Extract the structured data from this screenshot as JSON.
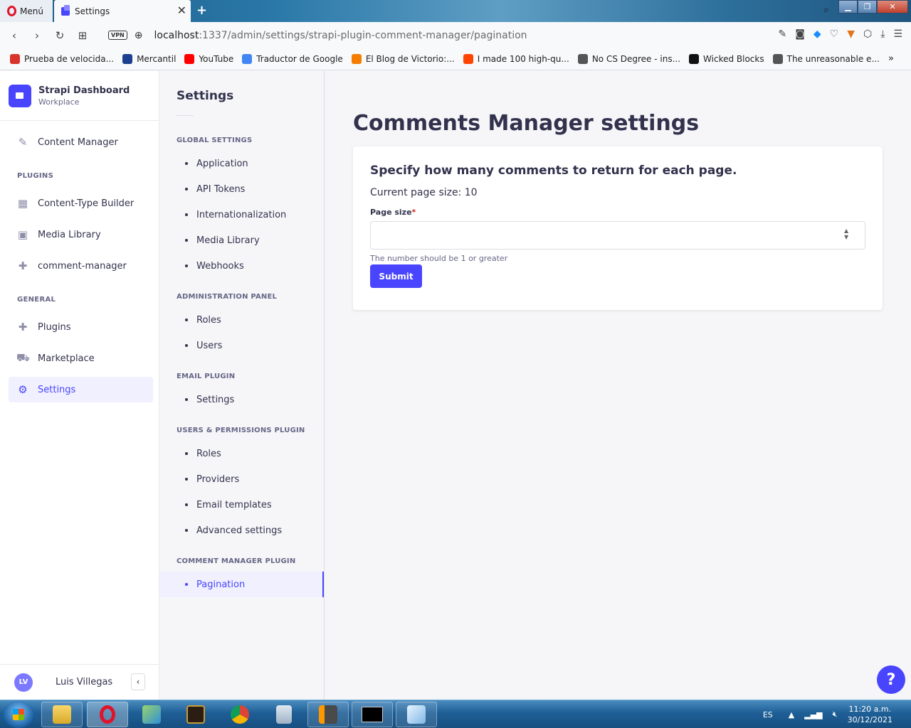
{
  "browser": {
    "menu_label": "Menú",
    "tab_title": "Settings",
    "tab_close": "✕",
    "new_tab": "+",
    "url_host": "localhost",
    "url_path": ":1337/admin/settings/strapi-plugin-comment-manager/pagination",
    "vpn_label": "VPN",
    "bookmarks": [
      {
        "label": "Prueba de velocida...",
        "color": "#d9342b"
      },
      {
        "label": "Mercantil",
        "color": "#1d3f8f"
      },
      {
        "label": "YouTube",
        "color": "#ff0000"
      },
      {
        "label": "Traductor de Google",
        "color": "#4285f4"
      },
      {
        "label": "El Blog de Victorio:...",
        "color": "#f57d00"
      },
      {
        "label": "I made 100 high-qu...",
        "color": "#ff4500"
      },
      {
        "label": "No CS Degree - ins...",
        "color": "#555555"
      },
      {
        "label": "Wicked Blocks",
        "color": "#111111"
      },
      {
        "label": "The unreasonable e...",
        "color": "#555555"
      }
    ],
    "more_bookmarks": "»"
  },
  "strapi": {
    "brand_title": "Strapi Dashboard",
    "brand_subtitle": "Workplace",
    "nav_content_manager": "Content Manager",
    "section_plugins": "PLUGINS",
    "nav_ctb": "Content-Type Builder",
    "nav_media": "Media Library",
    "nav_comment": "comment-manager",
    "section_general": "GENERAL",
    "nav_plugins": "Plugins",
    "nav_marketplace": "Marketplace",
    "nav_settings": "Settings",
    "user_initials": "LV",
    "user_name": "Luis Villegas",
    "collapse": "‹"
  },
  "settings_nav": {
    "title": "Settings",
    "global_settings": "GLOBAL SETTINGS",
    "application": "Application",
    "api_tokens": "API Tokens",
    "i18n": "Internationalization",
    "media_library": "Media Library",
    "webhooks": "Webhooks",
    "admin_panel": "ADMINISTRATION PANEL",
    "admin_roles": "Roles",
    "admin_users": "Users",
    "email_plugin": "EMAIL PLUGIN",
    "email_settings": "Settings",
    "users_permissions": "USERS & PERMISSIONS PLUGIN",
    "up_roles": "Roles",
    "up_providers": "Providers",
    "up_email_templates": "Email templates",
    "up_advanced": "Advanced settings",
    "comment_plugin": "COMMENT MANAGER PLUGIN",
    "pagination": "Pagination"
  },
  "main": {
    "title": "Comments Manager settings",
    "heading": "Specify how many comments to return for each page.",
    "current_size": "Current page size: 10",
    "field_label": "Page size",
    "required_mark": "*",
    "input_value": "",
    "hint": "The number should be 1 or greater",
    "submit": "Submit",
    "help": "?"
  },
  "taskbar": {
    "lang": "ES",
    "time": "11:20 a.m.",
    "date": "30/12/2021"
  }
}
